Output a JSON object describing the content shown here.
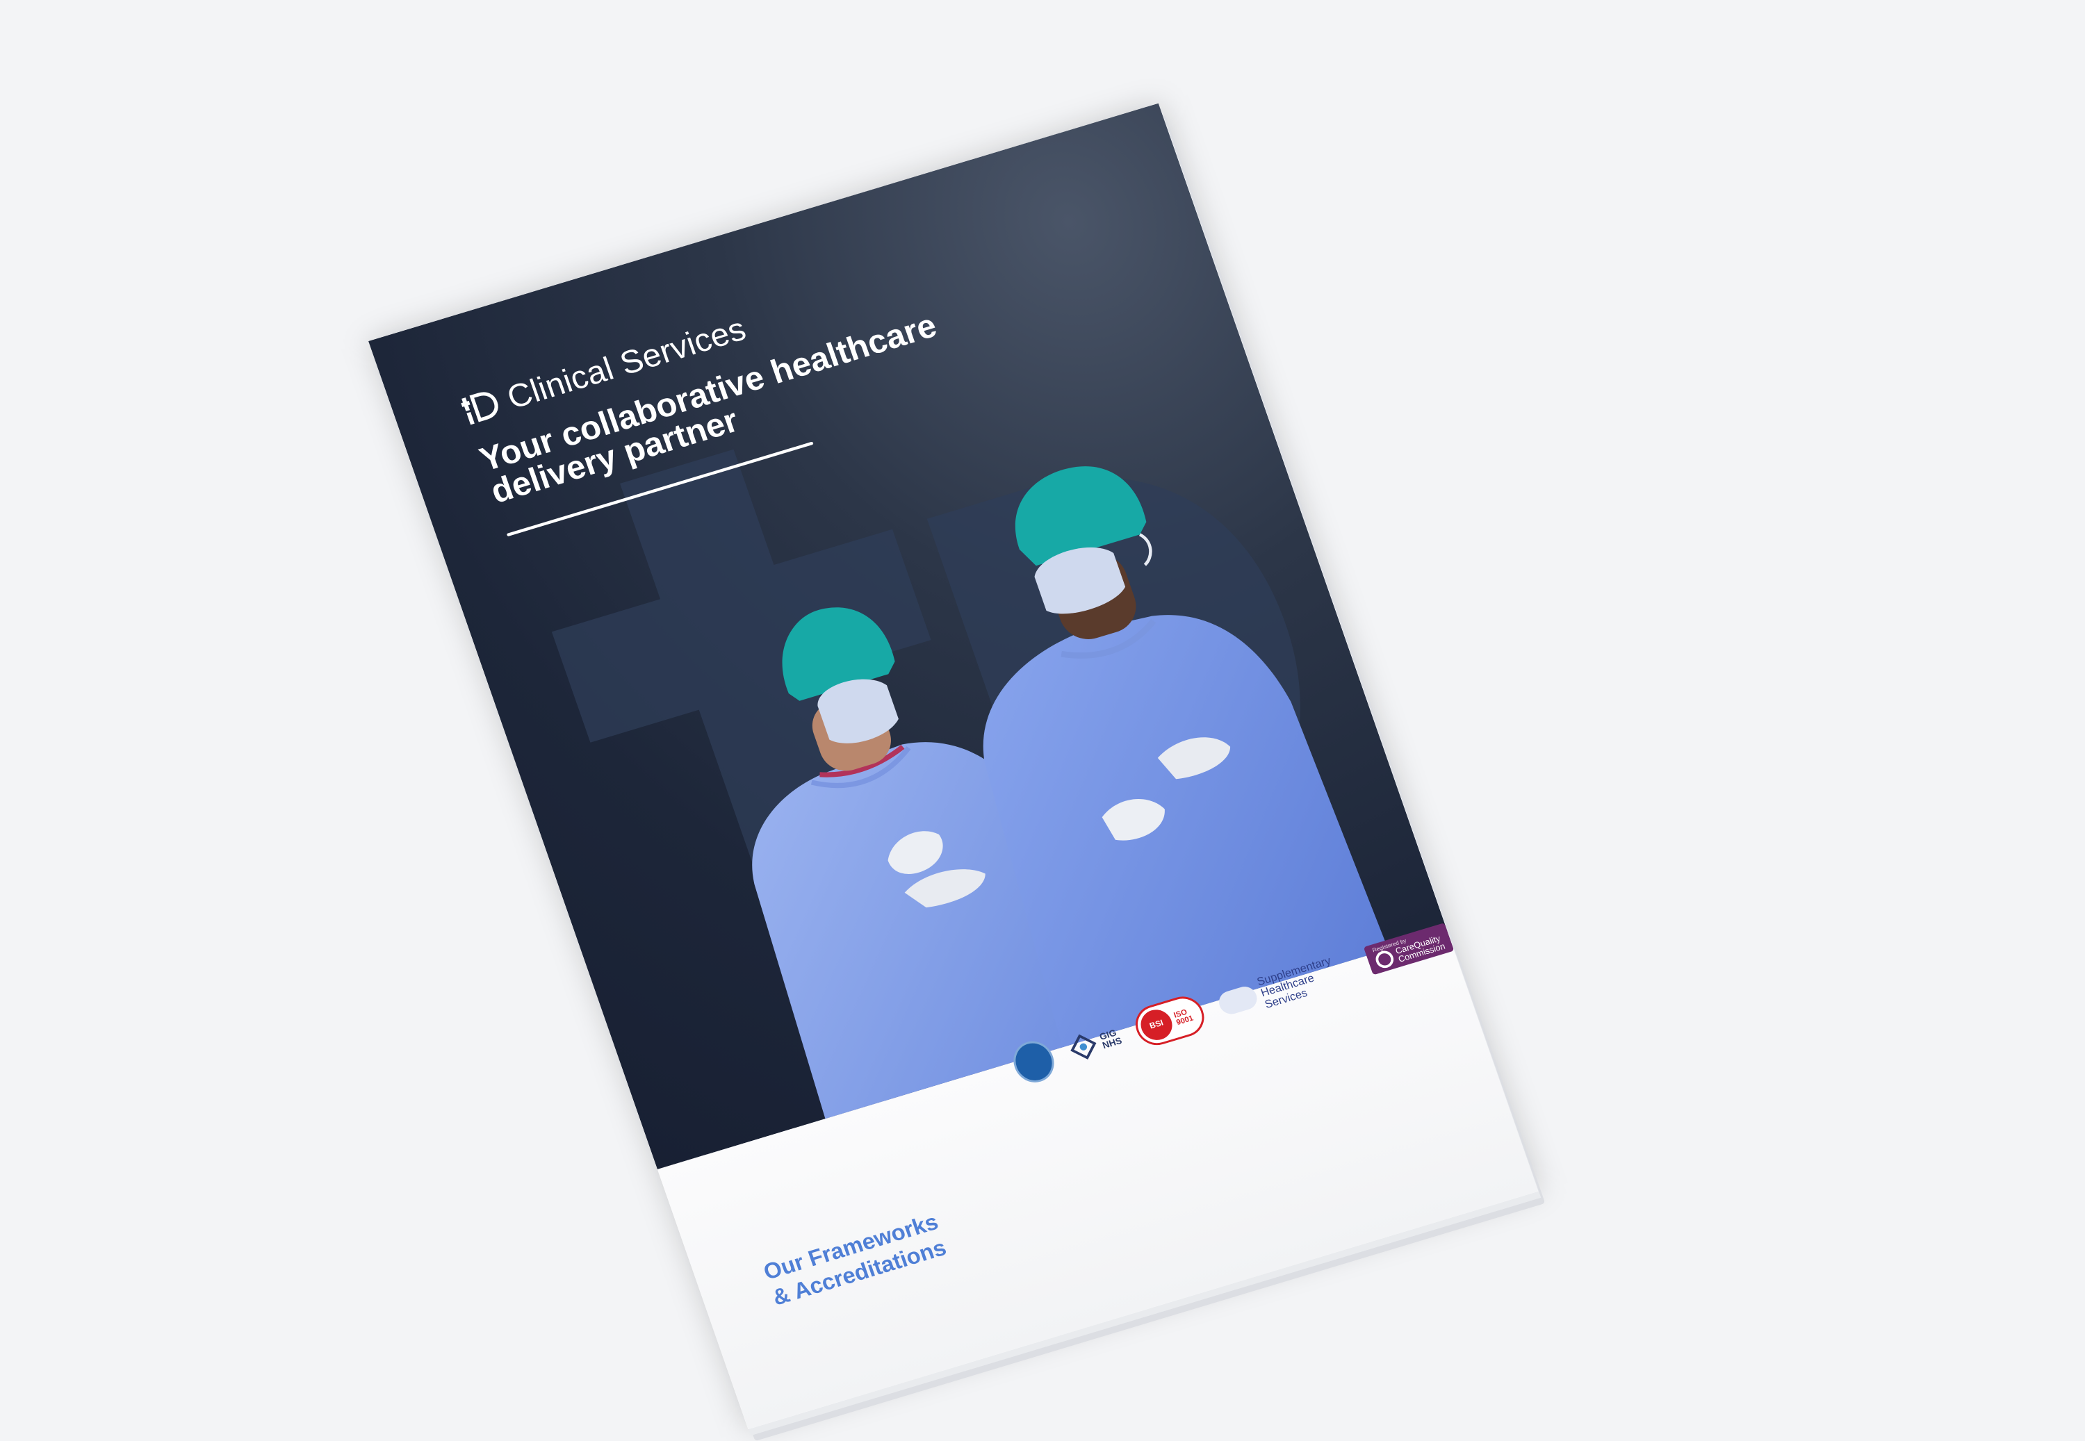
{
  "cover": {
    "brand": "Clinical Services",
    "tagline_line1": "Your collaborative healthcare",
    "tagline_line2": "delivery partner",
    "footer_line1": "Our Frameworks",
    "footer_line2": "& Accreditations"
  },
  "accreditations": {
    "gig_line1": "GIG",
    "gig_line2": "NHS",
    "iso_mark": "BSI",
    "iso_line1": "ISO",
    "iso_line2": "9001",
    "shs_line1": "Supplementary",
    "shs_line2": "Healthcare Services",
    "cqc_registered": "Registered by",
    "cqc_line1": "CareQuality",
    "cqc_line2": "Commission"
  },
  "colors": {
    "cover_dark": "#1d2639",
    "accent_blue": "#4f7fd6",
    "scrubs_blue": "#8fa9ea",
    "cap_teal": "#17a9a6",
    "cqc_purple": "#6c2a6e",
    "iso_red": "#d61f26"
  },
  "icons": {
    "brand_logo": "id-plus-icon",
    "frameworks_badge": "round-seal-icon",
    "gig_badge": "diamond-knot-icon",
    "cqc_badge": "q-ring-icon"
  }
}
